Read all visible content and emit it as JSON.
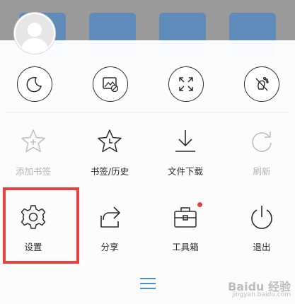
{
  "background_tiles": [
    {
      "name": "bg-app-tile-1",
      "color": "#2f7fd6"
    },
    {
      "name": "bg-app-tile-2",
      "color": "#2f7fd6"
    },
    {
      "name": "bg-app-tile-3",
      "color": "#2f7fd6"
    },
    {
      "name": "bg-app-tile-4",
      "color": "#2f7fd6"
    }
  ],
  "quick_toggles": [
    {
      "icon": "moon-icon",
      "name": "night-mode-button"
    },
    {
      "icon": "no-image-icon",
      "name": "no-image-mode-button"
    },
    {
      "icon": "fullscreen-icon",
      "name": "fullscreen-button"
    },
    {
      "icon": "no-trace-icon",
      "name": "incognito-button"
    }
  ],
  "menu": {
    "row1": [
      {
        "label": "添加书签",
        "icon": "star-plus-icon",
        "disabled": true
      },
      {
        "label": "书签/历史",
        "icon": "star-clock-icon",
        "disabled": false
      },
      {
        "label": "文件下载",
        "icon": "download-icon",
        "disabled": false
      },
      {
        "label": "刷新",
        "icon": "refresh-icon",
        "disabled": true
      }
    ],
    "row2": [
      {
        "label": "设置",
        "icon": "gear-icon",
        "disabled": false
      },
      {
        "label": "分享",
        "icon": "share-icon",
        "disabled": false
      },
      {
        "label": "工具箱",
        "icon": "toolbox-icon",
        "disabled": false,
        "badge": true
      },
      {
        "label": "退出",
        "icon": "power-icon",
        "disabled": false
      }
    ]
  },
  "colors": {
    "highlight": "#e8423c",
    "accent": "#2f7fd6",
    "badge": "#e8423c"
  },
  "watermark": {
    "line1": "Baidu 经验",
    "line2": "jingyan.baidu.com"
  }
}
